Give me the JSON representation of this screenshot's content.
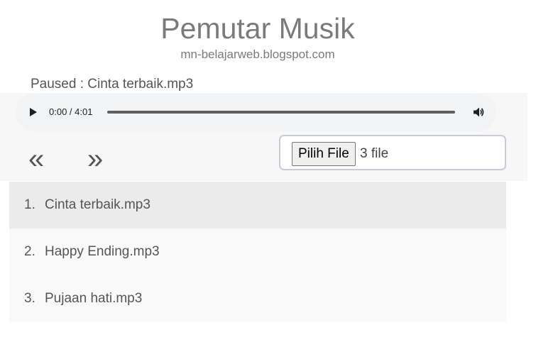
{
  "header": {
    "title": "Pemutar Musik",
    "subtitle": "mn-belajarweb.blogspot.com"
  },
  "status": {
    "text": "Paused : Cinta terbaik.mp3"
  },
  "audio_player": {
    "time": "0:00 / 4:01",
    "progress_fraction": 0,
    "play_icon": "play-icon",
    "volume_icon": "volume-icon"
  },
  "navigation": {
    "prev_label": "«",
    "next_label": "»"
  },
  "file_input": {
    "button_label": "Pilih File",
    "selected_text": "3 file"
  },
  "playlist": {
    "active_index": 0,
    "items": [
      {
        "number": "1.",
        "title": "Cinta terbaik.mp3"
      },
      {
        "number": "2.",
        "title": "Happy Ending.mp3"
      },
      {
        "number": "3.",
        "title": "Pujaan hati.mp3"
      }
    ]
  },
  "colors": {
    "player_background": "#f1f3f4",
    "active_row": "#ebebeb",
    "row": "#f9f9f9",
    "text": "#555555"
  }
}
